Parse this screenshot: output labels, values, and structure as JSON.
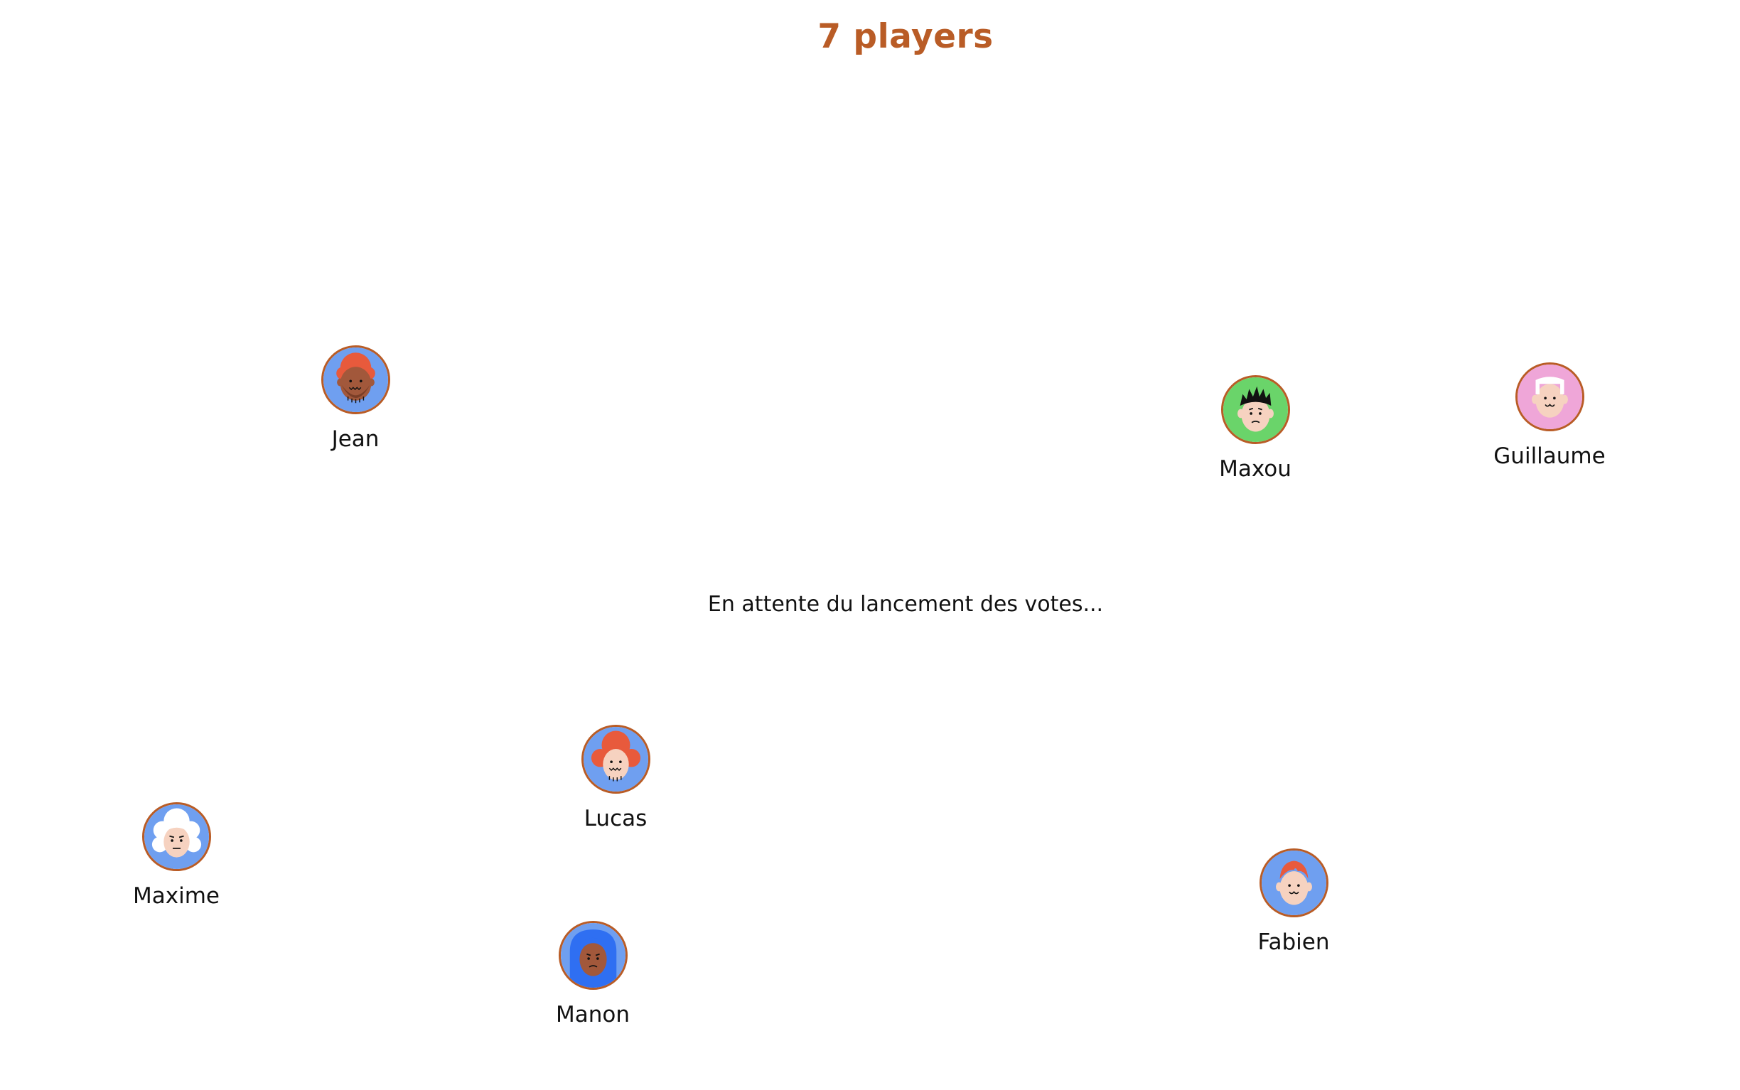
{
  "header": {
    "player_count": "7 players"
  },
  "status": {
    "text": "En attente du lancement des votes..."
  },
  "colors": {
    "accent": "#b95c26",
    "avatar_blue": "#6f9ff0",
    "avatar_green": "#6ad46a",
    "avatar_pink": "#efa6d8",
    "avatar_royal": "#2f6ff2"
  },
  "players": [
    {
      "name": "Jean",
      "icon": "avatar-bearded-red-hair-icon"
    },
    {
      "name": "Maxou",
      "icon": "avatar-spiky-black-hair-icon"
    },
    {
      "name": "Guillaume",
      "icon": "avatar-white-hair-icon"
    },
    {
      "name": "Lucas",
      "icon": "avatar-red-curly-hair-icon"
    },
    {
      "name": "Maxime",
      "icon": "avatar-white-curly-hair-icon"
    },
    {
      "name": "Manon",
      "icon": "avatar-blue-hood-icon"
    },
    {
      "name": "Fabien",
      "icon": "avatar-red-hair-smile-icon"
    }
  ]
}
